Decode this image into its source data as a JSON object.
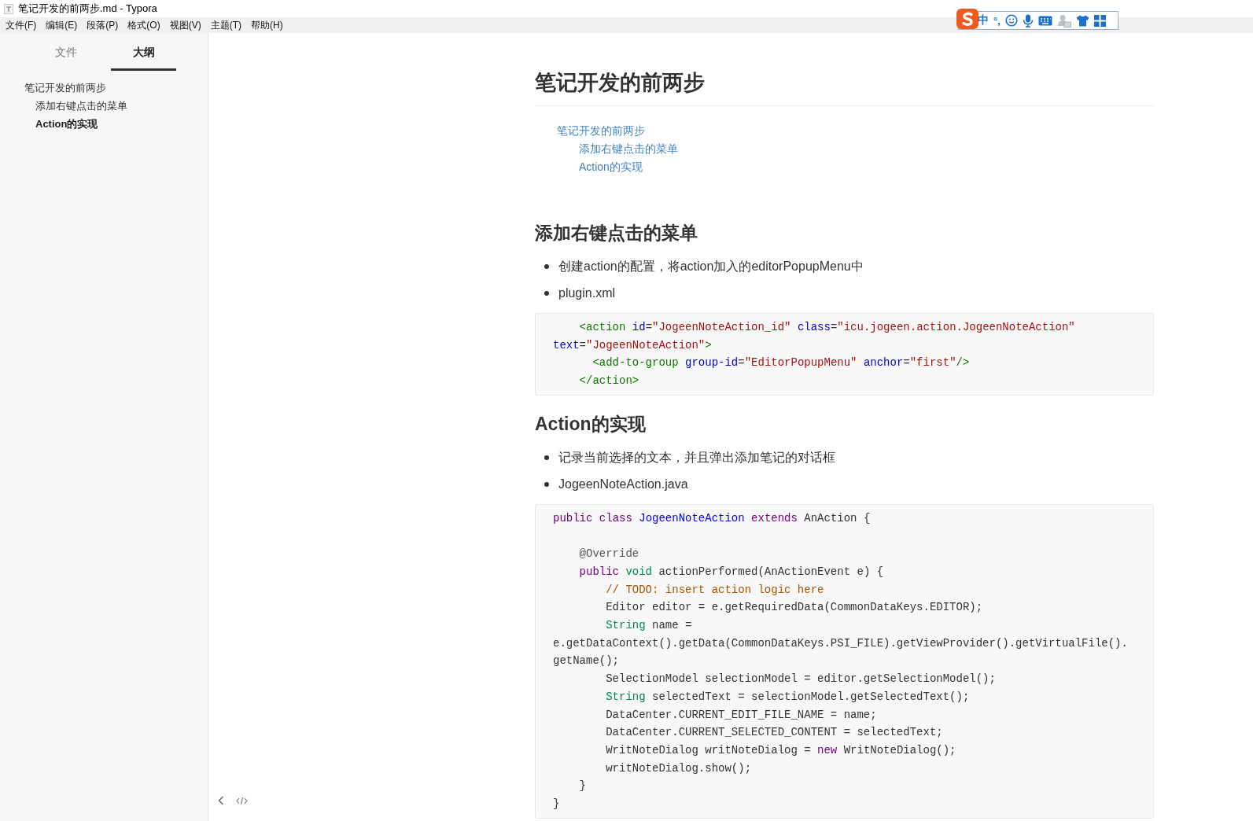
{
  "window": {
    "title": "笔记开发的前两步.md - Typora"
  },
  "menu": [
    "文件(F)",
    "编辑(E)",
    "段落(P)",
    "格式(O)",
    "视图(V)",
    "主题(T)",
    "帮助(H)"
  ],
  "ime_toolbar": {
    "mode": "中",
    "punctuation": "°,"
  },
  "sidebar": {
    "tabs": [
      {
        "label": "文件",
        "selected": false
      },
      {
        "label": "大纲",
        "selected": true
      }
    ],
    "outline": [
      {
        "label": "笔记开发的前两步",
        "selected": false,
        "children": [
          {
            "label": "添加右键点击的菜单",
            "selected": false
          },
          {
            "label": "Action的实现",
            "selected": true
          }
        ]
      }
    ]
  },
  "document": {
    "title": "笔记开发的前两步",
    "toc": [
      {
        "label": "笔记开发的前两步",
        "children": [
          {
            "label": "添加右键点击的菜单"
          },
          {
            "label": "Action的实现"
          }
        ]
      }
    ],
    "sections": [
      {
        "heading": "添加右键点击的菜单",
        "bullets": [
          "创建action的配置，将action加入的editorPopupMenu中",
          "plugin.xml"
        ],
        "code": [
          {
            "tokens": [
              {
                "t": "    <action",
                "kind": "tag"
              },
              {
                "t": " id",
                "kind": "attr"
              },
              {
                "t": "="
              },
              {
                "t": "\"JogeenNoteAction_id\"",
                "kind": "string"
              },
              {
                "t": " class",
                "kind": "attr"
              },
              {
                "t": "="
              },
              {
                "t": "\"icu.jogeen.action.JogeenNoteAction\"",
                "kind": "string"
              }
            ]
          },
          {
            "tokens": [
              {
                "t": "text",
                "kind": "attr"
              },
              {
                "t": "="
              },
              {
                "t": "\"JogeenNoteAction\"",
                "kind": "string"
              },
              {
                "t": ">",
                "kind": "tag"
              }
            ]
          },
          {
            "tokens": [
              {
                "t": "      <add-to-group",
                "kind": "tag"
              },
              {
                "t": " group-id",
                "kind": "attr"
              },
              {
                "t": "="
              },
              {
                "t": "\"EditorPopupMenu\"",
                "kind": "string"
              },
              {
                "t": " anchor",
                "kind": "attr"
              },
              {
                "t": "="
              },
              {
                "t": "\"first\"",
                "kind": "string"
              },
              {
                "t": "/>",
                "kind": "tag"
              }
            ]
          },
          {
            "tokens": [
              {
                "t": "    </action>",
                "kind": "tag"
              }
            ]
          }
        ]
      },
      {
        "heading": "Action的实现",
        "bullets": [
          "记录当前选择的文本，并且弹出添加笔记的对话框",
          "JogeenNoteAction.java"
        ],
        "code": [
          {
            "tokens": [
              {
                "t": "public",
                "kind": "keyword"
              },
              {
                "t": " class",
                "kind": "keyword"
              },
              {
                "t": " JogeenNoteAction",
                "kind": "def"
              },
              {
                "t": " extends",
                "kind": "keyword"
              },
              {
                "t": " AnAction {"
              }
            ]
          },
          {
            "kind": "blank"
          },
          {
            "tokens": [
              {
                "t": "    @Override",
                "kind": "meta"
              }
            ]
          },
          {
            "tokens": [
              {
                "t": "    public",
                "kind": "keyword"
              },
              {
                "t": " void",
                "kind": "type"
              },
              {
                "t": " actionPerformed(AnActionEvent e) {"
              }
            ]
          },
          {
            "tokens": [
              {
                "t": "        // TODO: insert action logic here",
                "kind": "comment"
              }
            ]
          },
          {
            "tokens": [
              {
                "t": "        Editor editor = e.getRequiredData(CommonDataKeys.EDITOR);"
              }
            ]
          },
          {
            "tokens": [
              {
                "t": "        String",
                "kind": "type"
              },
              {
                "t": " name ="
              }
            ]
          },
          {
            "tokens": [
              {
                "t": "e.getDataContext().getData(CommonDataKeys.PSI_FILE).getViewProvider().getVirtualFile()."
              }
            ]
          },
          {
            "tokens": [
              {
                "t": "getName();"
              }
            ]
          },
          {
            "tokens": [
              {
                "t": "        SelectionModel selectionModel = editor.getSelectionModel();"
              }
            ]
          },
          {
            "tokens": [
              {
                "t": "        String",
                "kind": "type"
              },
              {
                "t": " selectedText = selectionModel.getSelectedText();"
              }
            ]
          },
          {
            "tokens": [
              {
                "t": "        DataCenter.CURRENT_EDIT_FILE_NAME = name;"
              }
            ]
          },
          {
            "tokens": [
              {
                "t": "        DataCenter.CURRENT_SELECTED_CONTENT = selectedText;"
              }
            ]
          },
          {
            "tokens": [
              {
                "t": "        WritNoteDialog writNoteDialog = "
              },
              {
                "t": "new",
                "kind": "keyword"
              },
              {
                "t": " WritNoteDialog();"
              }
            ]
          },
          {
            "tokens": [
              {
                "t": "        writNoteDialog.show();"
              }
            ]
          },
          {
            "tokens": [
              {
                "t": "    }"
              }
            ]
          },
          {
            "tokens": [
              {
                "t": "}"
              }
            ]
          }
        ]
      }
    ]
  }
}
